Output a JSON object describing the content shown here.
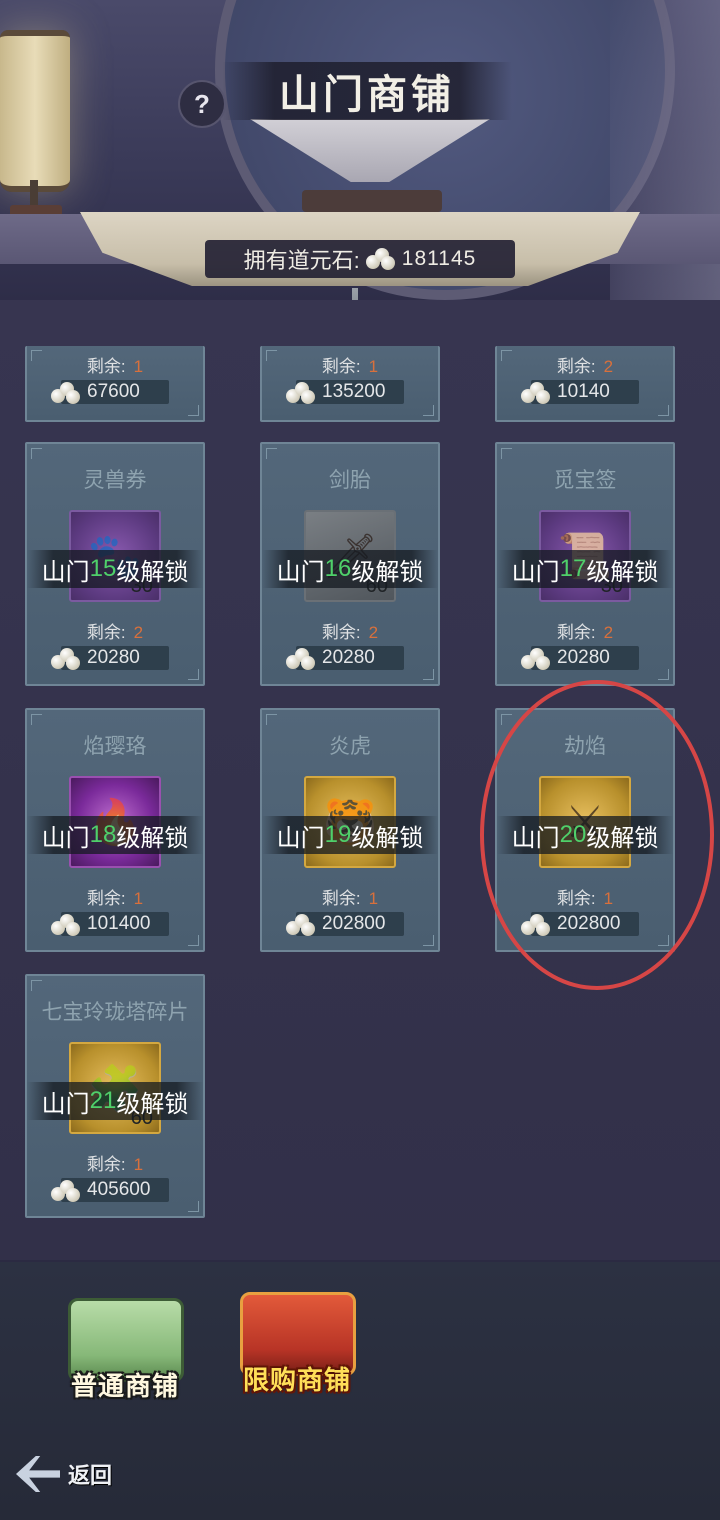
{
  "header": {
    "title": "山门商铺",
    "help_symbol": "?",
    "currency_label": "拥有道元石:",
    "currency_value": "181145"
  },
  "top_row": [
    {
      "remain_label": "剩余:",
      "remain": "1",
      "price": "67600"
    },
    {
      "remain_label": "剩余:",
      "remain": "1",
      "price": "135200"
    },
    {
      "remain_label": "剩余:",
      "remain": "2",
      "price": "10140"
    }
  ],
  "cards": [
    {
      "name": "灵兽券",
      "qty": "30",
      "unlock_prefix": "山门",
      "unlock_level": "15",
      "unlock_suffix": "级解锁",
      "remain_label": "剩余:",
      "remain": "2",
      "price": "20280"
    },
    {
      "name": "剑胎",
      "qty": "60",
      "unlock_prefix": "山门",
      "unlock_level": "16",
      "unlock_suffix": "级解锁",
      "remain_label": "剩余:",
      "remain": "2",
      "price": "20280"
    },
    {
      "name": "觅宝签",
      "qty": "30",
      "unlock_prefix": "山门",
      "unlock_level": "17",
      "unlock_suffix": "级解锁",
      "remain_label": "剩余:",
      "remain": "2",
      "price": "20280"
    },
    {
      "name": "焰璎珞",
      "qty": "",
      "unlock_prefix": "山门",
      "unlock_level": "18",
      "unlock_suffix": "级解锁",
      "remain_label": "剩余:",
      "remain": "1",
      "price": "101400"
    },
    {
      "name": "炎虎",
      "qty": "",
      "unlock_prefix": "山门",
      "unlock_level": "19",
      "unlock_suffix": "级解锁",
      "remain_label": "剩余:",
      "remain": "1",
      "price": "202800"
    },
    {
      "name": "劫焰",
      "qty": "",
      "unlock_prefix": "山门",
      "unlock_level": "20",
      "unlock_suffix": "级解锁",
      "remain_label": "剩余:",
      "remain": "1",
      "price": "202800"
    },
    {
      "name": "七宝玲珑塔碎片",
      "qty": "60",
      "unlock_prefix": "山门",
      "unlock_level": "21",
      "unlock_suffix": "级解锁",
      "remain_label": "剩余:",
      "remain": "1",
      "price": "405600"
    }
  ],
  "tabs": {
    "normal_label": "普通商铺",
    "limited_label": "限购商铺"
  },
  "back_label": "返回",
  "colors": {
    "unlock_level": "#4fd06a",
    "remain_count": "#d8703c",
    "highlight_ring": "#d64646"
  },
  "icons": [
    "help-icon",
    "stone-currency-icon",
    "back-arrow-icon",
    "paw-scroll-icon",
    "sword-icon",
    "talisman-icon",
    "fire-necklace-icon",
    "flame-tiger-icon",
    "calamity-flame-icon",
    "pagoda-fragment-icon"
  ]
}
